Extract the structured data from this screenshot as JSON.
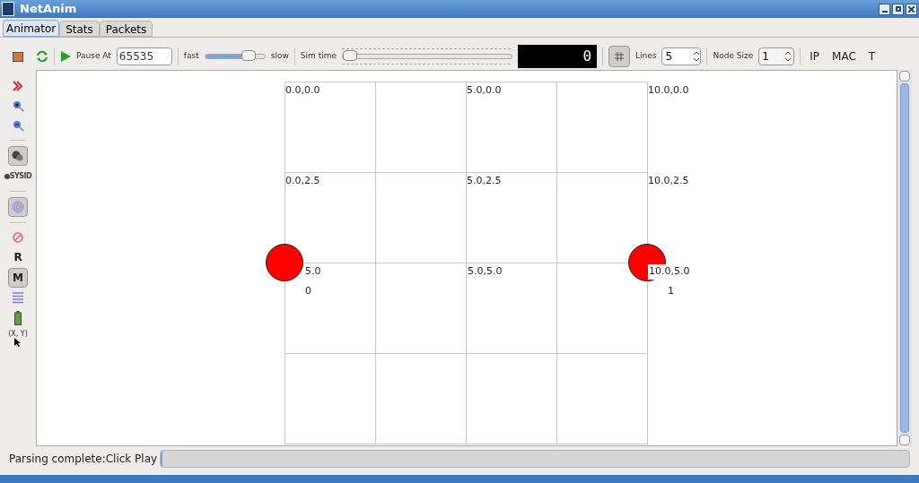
{
  "window": {
    "title": "NetAnim"
  },
  "tabs": [
    {
      "label": "Animator",
      "selected": true
    },
    {
      "label": "Stats",
      "selected": false
    },
    {
      "label": "Packets",
      "selected": false
    }
  ],
  "toolbar": {
    "pause_at_label": "Pause At",
    "pause_at_value": "65535",
    "fast_label": "fast",
    "speed": {
      "level": 0.8
    },
    "slow_label": "slow",
    "sim_time_label": "Sim time",
    "sim_time": {
      "level": 0
    },
    "lcd": "0",
    "grid_pressed": true,
    "lines_label": "Lines",
    "lines_value": "5",
    "node_size_label": "Node Size",
    "node_size_value": "1",
    "buttons": [
      "IP",
      "MAC",
      "T"
    ]
  },
  "side_tools": [
    {
      "kind": "chevrons",
      "pressed": false
    },
    {
      "kind": "zoom-in",
      "pressed": false
    },
    {
      "kind": "zoom-out",
      "pressed": false
    },
    {
      "kind": "sep"
    },
    {
      "kind": "shapes",
      "pressed": true
    },
    {
      "kind": "sysid",
      "pressed": false,
      "label": "SYSID"
    },
    {
      "kind": "sep"
    },
    {
      "kind": "fingerprint",
      "pressed": true
    },
    {
      "kind": "sep"
    },
    {
      "kind": "no-sign",
      "pressed": false
    },
    {
      "kind": "text",
      "label": "R",
      "pressed": false
    },
    {
      "kind": "text",
      "label": "M",
      "pressed": true
    },
    {
      "kind": "lines",
      "pressed": false
    },
    {
      "kind": "battery",
      "pressed": false
    },
    {
      "kind": "cursor",
      "pressed": false,
      "label": "(X, Y)"
    }
  ],
  "grid_labels": [
    "0.0,0.0",
    "5.0,0.0",
    "10.0,0.0",
    "0.0,2.5",
    "5.0,2.5",
    "10.0,2.5",
    "5.0",
    "5.0,5.0",
    "10.0,5.0"
  ],
  "nodes": [
    {
      "label": "0"
    },
    {
      "label": "1"
    }
  ],
  "status": {
    "text": "Parsing complete:Click Play",
    "progress": {
      "level": 0
    }
  }
}
